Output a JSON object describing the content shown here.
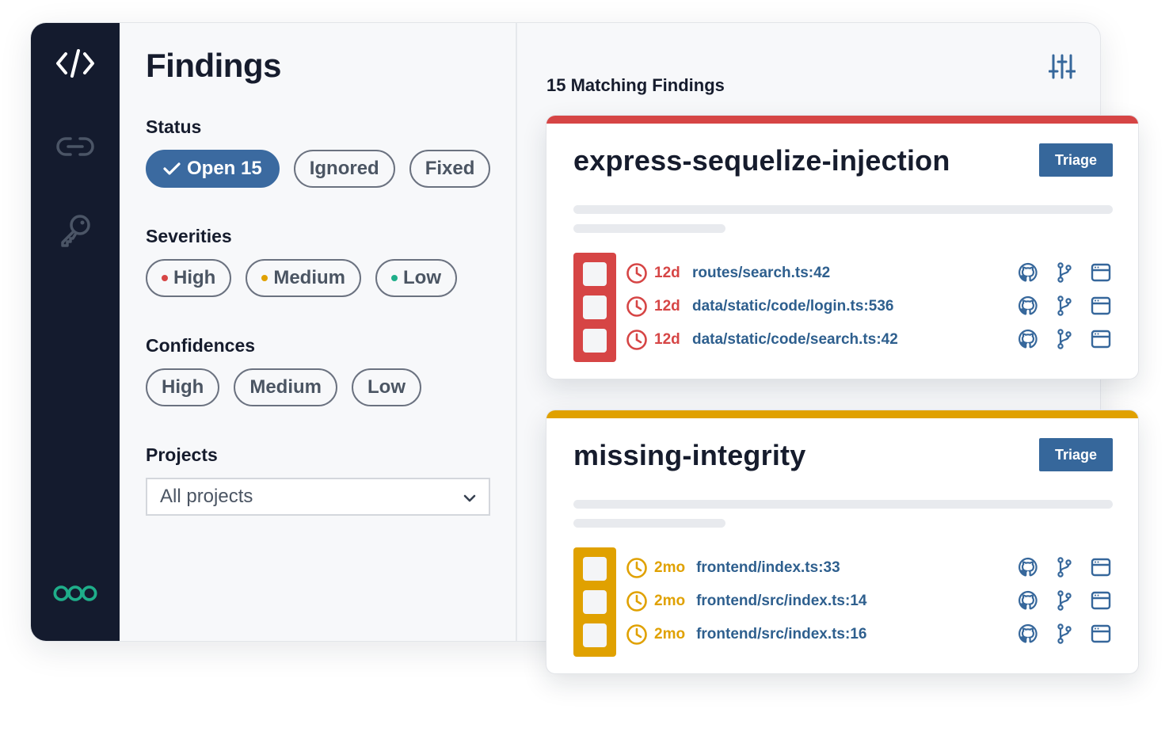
{
  "colors": {
    "sidebar_bg": "#141b2e",
    "accent": "#3b6aa0",
    "high": "#d64545",
    "medium": "#e0a100",
    "low": "#1fae8a",
    "path_link": "#2e5f8e"
  },
  "sidebar": {
    "items": [
      {
        "icon": "code-icon"
      },
      {
        "icon": "link-icon"
      },
      {
        "icon": "key-icon"
      },
      {
        "icon": "logo-icon"
      }
    ]
  },
  "filters": {
    "title": "Findings",
    "status": {
      "label": "Status",
      "options": [
        "Open 15",
        "Ignored",
        "Fixed"
      ],
      "selected": "Open 15"
    },
    "severities": {
      "label": "Severities",
      "options": [
        {
          "label": "High",
          "color": "#d64545"
        },
        {
          "label": "Medium",
          "color": "#e0a100"
        },
        {
          "label": "Low",
          "color": "#1fae8a"
        }
      ]
    },
    "confidences": {
      "label": "Confidences",
      "options": [
        "High",
        "Medium",
        "Low"
      ]
    },
    "projects": {
      "label": "Projects",
      "selected": "All projects"
    }
  },
  "results": {
    "header": "15 Matching Findings",
    "findings": [
      {
        "rule": "express-sequelize-injection",
        "severity_color": "#d64545",
        "triage_label": "Triage",
        "locations": [
          {
            "age": "12d",
            "path": "routes/search.ts:42"
          },
          {
            "age": "12d",
            "path": "data/static/code/login.ts:536"
          },
          {
            "age": "12d",
            "path": "data/static/code/search.ts:42"
          }
        ]
      },
      {
        "rule": "missing-integrity",
        "severity_color": "#e0a100",
        "triage_label": "Triage",
        "locations": [
          {
            "age": "2mo",
            "path": "frontend/index.ts:33"
          },
          {
            "age": "2mo",
            "path": "frontend/src/index.ts:14"
          },
          {
            "age": "2mo",
            "path": "frontend/src/index.ts:16"
          }
        ]
      }
    ]
  }
}
